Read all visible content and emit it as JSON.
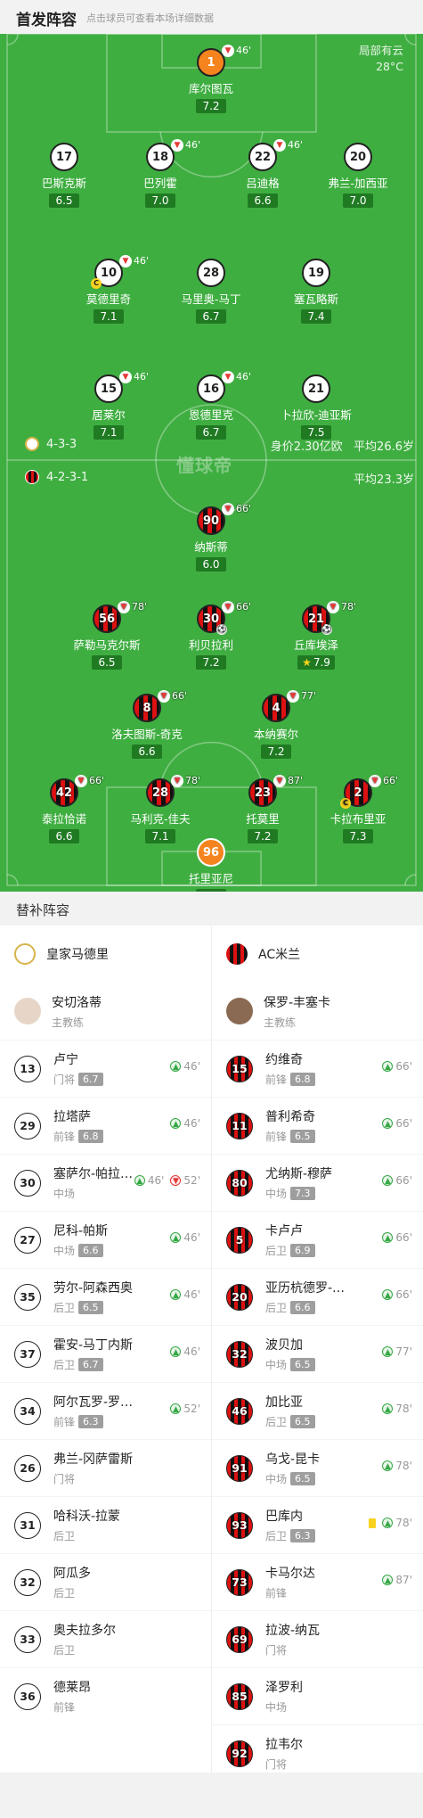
{
  "header": {
    "title": "首发阵容",
    "subtitle": "点击球员可查看本场详细数据"
  },
  "weather": {
    "condition": "局部有云",
    "temp": "28°C"
  },
  "home": {
    "formation": "4-3-3",
    "value": "身价2.30亿欧",
    "avg_age": "平均26.6岁",
    "color": "#ffffff"
  },
  "away": {
    "formation": "4-2-3-1",
    "avg_age": "平均23.3岁",
    "color": "#d11111"
  },
  "watermark": "懂球帝",
  "home_players": [
    {
      "num": "1",
      "name": "库尔图瓦",
      "rating": "7.2",
      "sub": "46'",
      "gk": true
    },
    {
      "num": "17",
      "name": "巴斯克斯",
      "rating": "6.5"
    },
    {
      "num": "18",
      "name": "巴列霍",
      "rating": "7.0",
      "sub": "46'"
    },
    {
      "num": "22",
      "name": "吕迪格",
      "rating": "6.6",
      "sub": "46'"
    },
    {
      "num": "20",
      "name": "弗兰-加西亚",
      "rating": "7.0"
    },
    {
      "num": "10",
      "name": "莫德里奇",
      "rating": "7.1",
      "sub": "46'",
      "yellow": true
    },
    {
      "num": "28",
      "name": "马里奥-马丁",
      "rating": "6.7"
    },
    {
      "num": "19",
      "name": "塞瓦略斯",
      "rating": "7.4"
    },
    {
      "num": "15",
      "name": "居莱尔",
      "rating": "7.1",
      "sub": "46'"
    },
    {
      "num": "16",
      "name": "恩德里克",
      "rating": "6.7",
      "sub": "46'"
    },
    {
      "num": "21",
      "name": "卜拉欣-迪亚斯",
      "rating": "7.5"
    }
  ],
  "away_players": [
    {
      "num": "90",
      "name": "纳斯蒂",
      "rating": "6.0",
      "sub": "66'"
    },
    {
      "num": "56",
      "name": "萨勒马克尔斯",
      "rating": "6.5",
      "sub": "78'"
    },
    {
      "num": "30",
      "name": "利贝拉利",
      "rating": "7.2",
      "sub": "66'",
      "own": true
    },
    {
      "num": "21",
      "name": "丘库埃泽",
      "rating": "7.9",
      "sub": "78'",
      "goal": true,
      "star": true
    },
    {
      "num": "8",
      "name": "洛夫图斯-奇克",
      "rating": "6.6",
      "sub": "66'"
    },
    {
      "num": "4",
      "name": "本纳赛尔",
      "rating": "7.2",
      "sub": "77'"
    },
    {
      "num": "42",
      "name": "泰拉恰诺",
      "rating": "6.6",
      "sub": "66'"
    },
    {
      "num": "28",
      "name": "马利克-佳夫",
      "rating": "7.1",
      "sub": "78'"
    },
    {
      "num": "23",
      "name": "托莫里",
      "rating": "7.2",
      "sub": "87'"
    },
    {
      "num": "2",
      "name": "卡拉布里亚",
      "rating": "7.3",
      "sub": "66'",
      "yellow": true
    },
    {
      "num": "96",
      "name": "托里亚尼",
      "rating": "6.9",
      "gk": true
    }
  ],
  "subs_section": {
    "title": "替补阵容"
  },
  "subs": {
    "home_team": "皇家马德里",
    "away_team": "AC米兰",
    "home_coach": {
      "name": "安切洛蒂",
      "role": "主教练"
    },
    "away_coach": {
      "name": "保罗-丰塞卡",
      "role": "主教练"
    },
    "home": [
      {
        "num": "13",
        "name": "卢宁",
        "pos": "门将",
        "rating": "6.7",
        "in": "46'"
      },
      {
        "num": "29",
        "name": "拉塔萨",
        "pos": "前锋",
        "rating": "6.8",
        "in": "46'"
      },
      {
        "num": "30",
        "name": "塞萨尔-帕拉…",
        "pos": "中场",
        "rating": "",
        "in": "46'",
        "out": "52'"
      },
      {
        "num": "27",
        "name": "尼科-帕斯",
        "pos": "中场",
        "rating": "6.6",
        "in": "46'"
      },
      {
        "num": "35",
        "name": "劳尔-阿森西奥",
        "pos": "后卫",
        "rating": "6.5",
        "in": "46'"
      },
      {
        "num": "37",
        "name": "霍安-马丁内斯",
        "pos": "后卫",
        "rating": "6.7",
        "in": "46'"
      },
      {
        "num": "34",
        "name": "阿尔瓦罗-罗…",
        "pos": "前锋",
        "rating": "6.3",
        "in": "52'"
      },
      {
        "num": "26",
        "name": "弗兰-冈萨雷斯",
        "pos": "门将",
        "rating": ""
      },
      {
        "num": "31",
        "name": "哈科沃-拉蒙",
        "pos": "后卫",
        "rating": ""
      },
      {
        "num": "32",
        "name": "阿瓜多",
        "pos": "后卫",
        "rating": ""
      },
      {
        "num": "33",
        "name": "奥夫拉多尔",
        "pos": "后卫",
        "rating": ""
      },
      {
        "num": "36",
        "name": "德莱昂",
        "pos": "前锋",
        "rating": ""
      }
    ],
    "away": [
      {
        "num": "15",
        "name": "约维奇",
        "pos": "前锋",
        "rating": "6.8",
        "in": "66'"
      },
      {
        "num": "11",
        "name": "普利希奇",
        "pos": "前锋",
        "rating": "6.5",
        "in": "66'"
      },
      {
        "num": "80",
        "name": "尤纳斯-穆萨",
        "pos": "中场",
        "rating": "7.3",
        "in": "66'"
      },
      {
        "num": "5",
        "name": "卡卢卢",
        "pos": "后卫",
        "rating": "6.9",
        "in": "66'"
      },
      {
        "num": "20",
        "name": "亚历杭德罗-…",
        "pos": "后卫",
        "rating": "6.6",
        "in": "66'"
      },
      {
        "num": "32",
        "name": "波贝加",
        "pos": "中场",
        "rating": "6.5",
        "in": "77'"
      },
      {
        "num": "46",
        "name": "加比亚",
        "pos": "后卫",
        "rating": "6.5",
        "in": "78'"
      },
      {
        "num": "91",
        "name": "乌戈-昆卡",
        "pos": "中场",
        "rating": "6.5",
        "in": "78'"
      },
      {
        "num": "93",
        "name": "巴库内",
        "pos": "后卫",
        "rating": "6.3",
        "in": "78'",
        "yellow": true
      },
      {
        "num": "73",
        "name": "卡马尔达",
        "pos": "前锋",
        "rating": "",
        "in": "87'"
      },
      {
        "num": "69",
        "name": "拉波-纳瓦",
        "pos": "门将",
        "rating": ""
      },
      {
        "num": "85",
        "name": "泽罗利",
        "pos": "中场",
        "rating": ""
      },
      {
        "num": "92",
        "name": "拉韦尔",
        "pos": "门将",
        "rating": ""
      }
    ]
  }
}
